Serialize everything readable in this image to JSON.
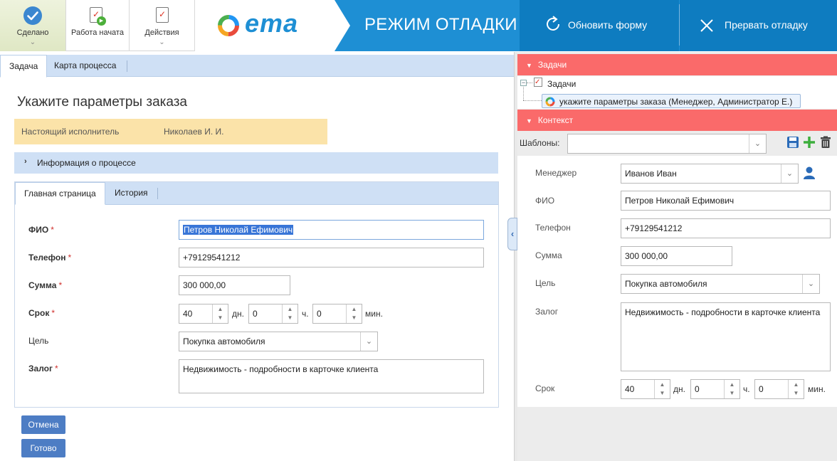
{
  "toolbar": {
    "done_label": "Сделано",
    "work_started_label": "Работа начата",
    "actions_label": "Действия",
    "logo_text": "ema",
    "debug_mode_title": "РЕЖИМ ОТЛАДКИ",
    "refresh_form_label": "Обновить форму",
    "stop_debug_label": "Прервать отладку"
  },
  "left": {
    "tabs": [
      "Задача",
      "Карта процесса"
    ],
    "page_title": "Укажите параметры заказа",
    "executor_label": "Настоящий исполнитель",
    "executor_value": "Николаев И. И.",
    "process_info_label": "Информация о процессе",
    "form_tabs": [
      "Главная страница",
      "История"
    ],
    "fields": {
      "fio_label": "ФИО",
      "fio_value": "Петров Николай Ефимович",
      "phone_label": "Телефон",
      "phone_value": "+79129541212",
      "sum_label": "Сумма",
      "sum_value": "300 000,00",
      "term_label": "Срок",
      "term_days": "40",
      "term_days_unit": "дн.",
      "term_hours": "0",
      "term_hours_unit": "ч.",
      "term_minutes": "0",
      "term_minutes_unit": "мин.",
      "goal_label": "Цель",
      "goal_value": "Покупка автомобиля",
      "pledge_label": "Залог",
      "pledge_value": "Недвижимость  - подробности в карточке клиента",
      "required_mark": "*"
    },
    "cancel_label": "Отмена",
    "ready_label": "Готово"
  },
  "right": {
    "tasks_header": "Задачи",
    "tree_root": "Задачи",
    "tree_child": "укажите параметры заказа (Менеджер, Администратор Е.)",
    "context_header": "Контекст",
    "templates_label": "Шаблоны:",
    "templates_value": "",
    "fields": {
      "manager_label": "Менеджер",
      "manager_value": "Иванов Иван",
      "fio_label": "ФИО",
      "fio_value": "Петров Николай Ефимович",
      "phone_label": "Телефон",
      "phone_value": "+79129541212",
      "sum_label": "Сумма",
      "sum_value": "300 000,00",
      "goal_label": "Цель",
      "goal_value": "Покупка автомобиля",
      "pledge_label": "Залог",
      "pledge_value": "Недвижимость  - подробности в карточке клиента",
      "term_label": "Срок",
      "term_days": "40",
      "term_days_unit": "дн.",
      "term_hours": "0",
      "term_hours_unit": "ч.",
      "term_minutes": "0",
      "term_minutes_unit": "мин."
    }
  },
  "colors": {
    "accent_blue": "#1e8fd4",
    "dark_blue": "#0e7cc0",
    "header_red": "#fa6a6a",
    "tab_blue": "#cfe0f5",
    "executor_bg": "#fbe3a9",
    "button_blue": "#4d7dc4"
  }
}
